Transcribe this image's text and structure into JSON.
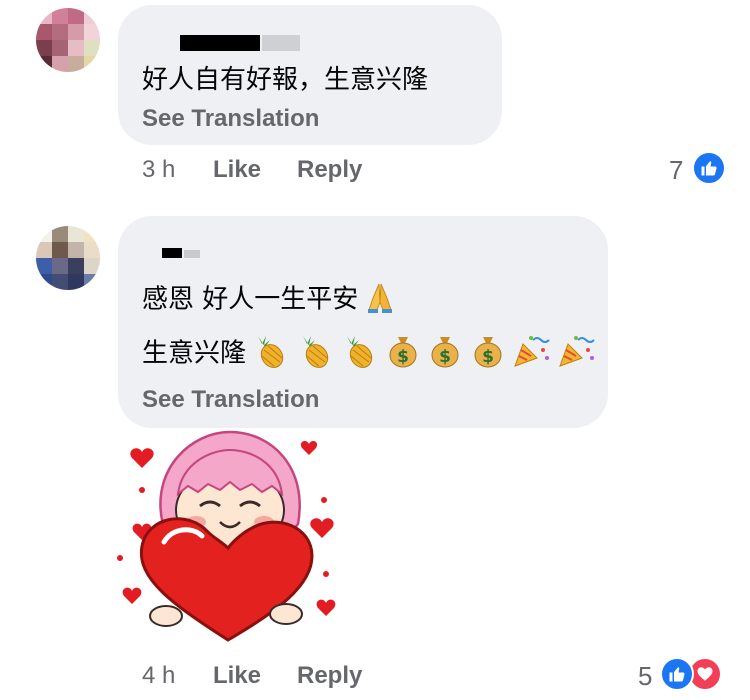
{
  "comments": [
    {
      "text": "好人自有好報，生意兴隆",
      "see_translation": "See Translation",
      "time": "3 h",
      "like": "Like",
      "reply": "Reply",
      "reaction_count": "7"
    },
    {
      "line1": "感恩 好人一生平安",
      "line2": "生意兴隆",
      "see_translation": "See Translation",
      "time": "4 h",
      "like": "Like",
      "reply": "Reply",
      "reaction_count": "5"
    }
  ],
  "icons": [
    "like-icon",
    "love-icon",
    "folded-hands-emoji",
    "pineapple-emoji",
    "money-bag-emoji",
    "party-popper-emoji",
    "heart-girl-sticker"
  ],
  "colors": {
    "bubble": "#eff0f3",
    "meta": "#65676b",
    "like": "#1a76f2",
    "love": "#f33e58",
    "text": "#050505"
  }
}
